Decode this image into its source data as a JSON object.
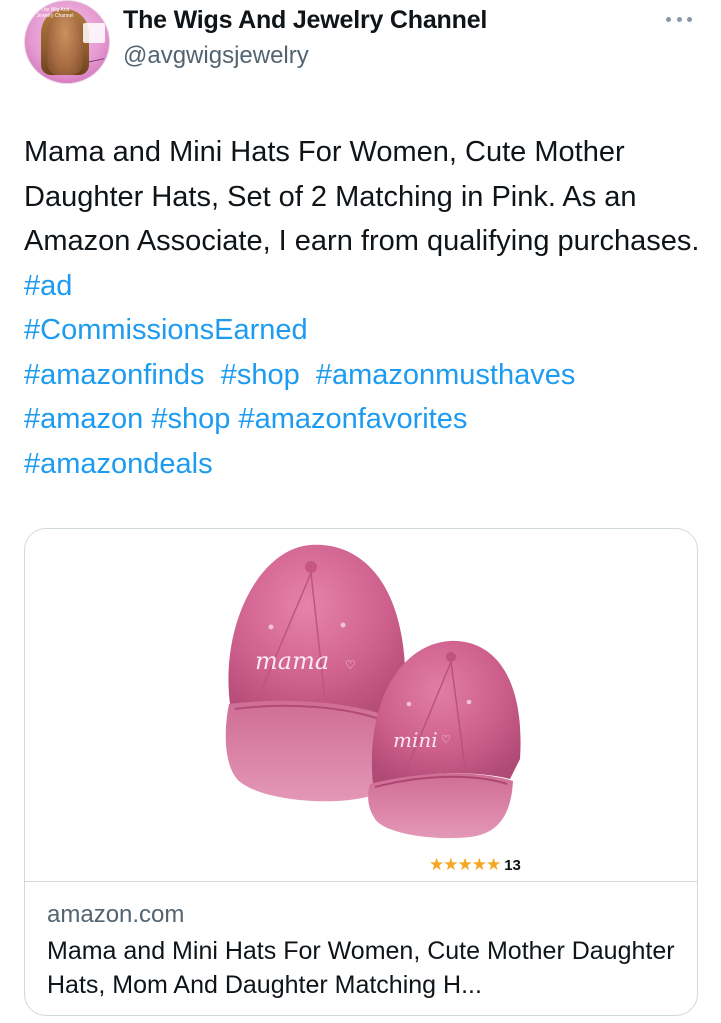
{
  "author": {
    "display_name": "The Wigs And Jewelry Channel",
    "handle": "@avgwigsjewelry",
    "avatar_caption": "The Wig And Jewelry Channel"
  },
  "more_icon": "more-horizontal-icon",
  "tweet": {
    "text": "Mama and Mini Hats For Women, Cute Mother Daughter Hats, Set of 2 Matching in Pink. As an Amazon Associate, I earn from qualifying purchases.",
    "hashtags": [
      "#ad",
      "#CommissionsEarned",
      "#amazonfinds",
      "#shop",
      "#amazonmusthaves",
      "#amazon",
      "#shop",
      "#amazonfavorites",
      "#amazondeals"
    ]
  },
  "card": {
    "domain": "amazon.com",
    "title": "Mama and Mini Hats For Women, Cute Mother Daughter Hats, Mom And Daughter Matching H...",
    "image": {
      "big_hat_text": "mama",
      "small_hat_text": "mini",
      "stars": "★★★★★",
      "rating_count": "13"
    }
  },
  "colors": {
    "link": "#1d9bf0",
    "text": "#0f1419",
    "secondary": "#536471",
    "hat_pink": "#d3638f"
  }
}
